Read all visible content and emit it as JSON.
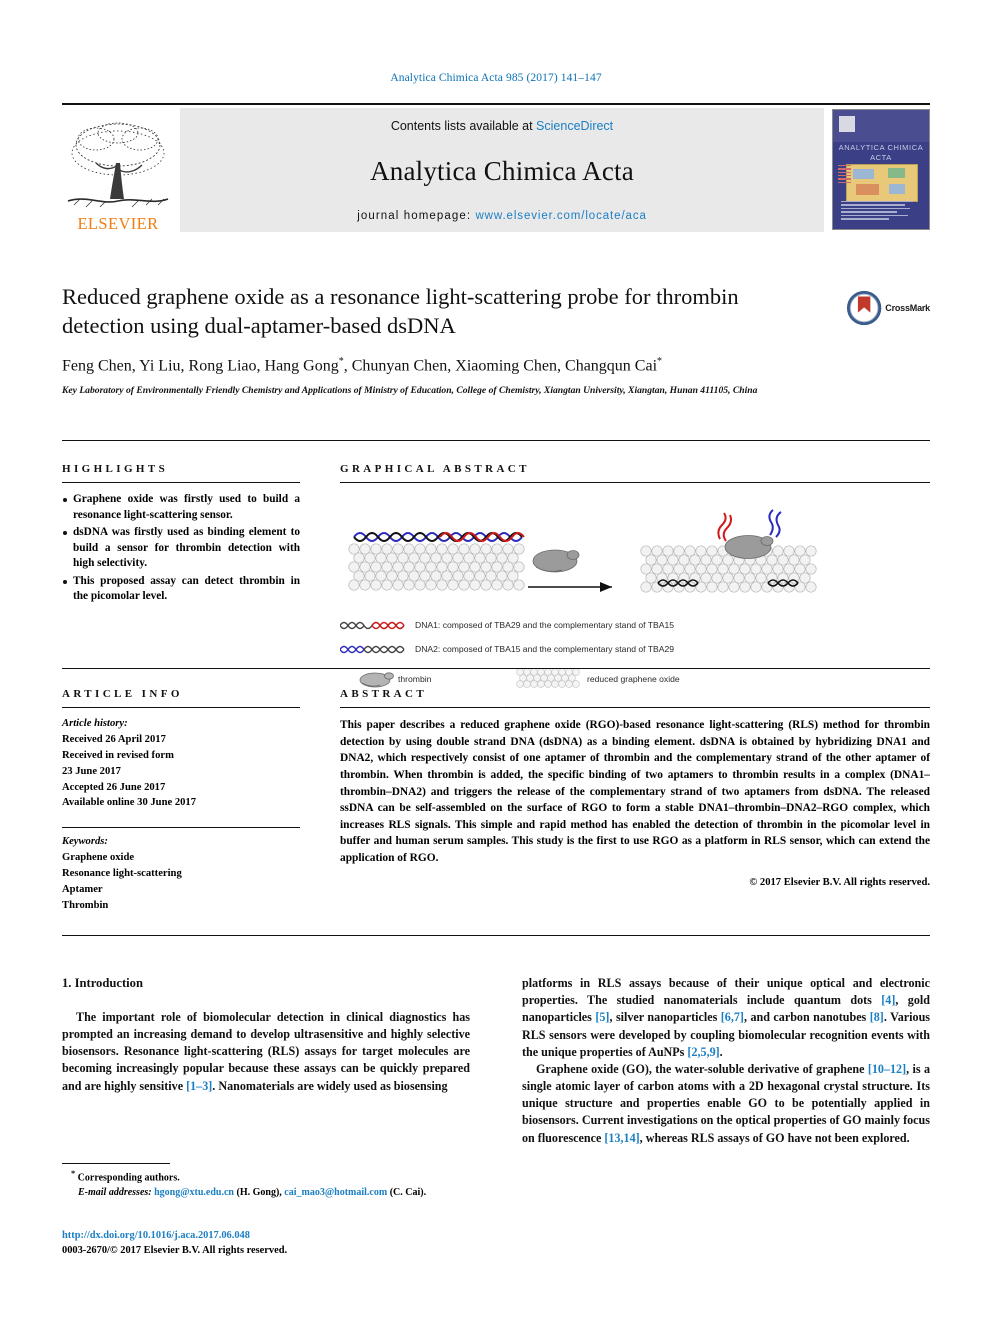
{
  "running_head": "Analytica Chimica Acta 985 (2017) 141–147",
  "masthead": {
    "publisher": "ELSEVIER",
    "contents_prefix": "Contents lists available at ",
    "contents_link": "ScienceDirect",
    "journal_title": "Analytica Chimica Acta",
    "homepage_prefix": "journal homepage: ",
    "homepage_url": "www.elsevier.com/locate/aca",
    "cover_title": "ANALYTICA CHIMICA ACTA"
  },
  "article": {
    "title": "Reduced graphene oxide as a resonance light-scattering probe for thrombin detection using dual-aptamer-based dsDNA",
    "authors": "Feng Chen, Yi Liu, Rong Liao, Hang Gong",
    "authors_mid": ", Chunyan Chen, Xiaoming Chen, Changqun Cai",
    "affiliation": "Key Laboratory of Environmentally Friendly Chemistry and Applications of Ministry of Education, College of Chemistry, Xiangtan University, Xiangtan, Hunan 411105, China",
    "crossmark_label": "CrossMark"
  },
  "highlights": {
    "heading": "HIGHLIGHTS",
    "items": [
      "Graphene oxide was firstly used to build a resonance light-scattering sensor.",
      "dsDNA was firstly used as binding element to build a sensor for thrombin detection with high selectivity.",
      "This proposed assay can detect thrombin in the picomolar level."
    ]
  },
  "graphical_abstract": {
    "heading": "GRAPHICAL ABSTRACT",
    "legend": [
      "DNA1: composed of TBA29 and the complementary stand of TBA15",
      "DNA2: composed of TBA15 and the complementary stand of TBA29"
    ],
    "legend_thrombin": "thrombin",
    "legend_rgo": "reduced graphene oxide"
  },
  "article_info": {
    "heading": "ARTICLE INFO",
    "history_label": "Article history:",
    "history": [
      "Received 26 April 2017",
      "Received in revised form",
      "23 June 2017",
      "Accepted 26 June 2017",
      "Available online 30 June 2017"
    ],
    "keywords_label": "Keywords:",
    "keywords": [
      "Graphene oxide",
      "Resonance light-scattering",
      "Aptamer",
      "Thrombin"
    ]
  },
  "abstract": {
    "heading": "ABSTRACT",
    "text": "This paper describes a reduced graphene oxide (RGO)-based resonance light-scattering (RLS) method for thrombin detection by using double strand DNA (dsDNA) as a binding element. dsDNA is obtained by hybridizing DNA1 and DNA2, which respectively consist of one aptamer of thrombin and the complementary strand of the other aptamer of thrombin. When thrombin is added, the specific binding of two aptamers to thrombin results in a complex (DNA1–thrombin–DNA2) and triggers the release of the complementary strand of two aptamers from dsDNA. The released ssDNA can be self-assembled on the surface of RGO to form a stable DNA1–thrombin–DNA2–RGO complex, which increases RLS signals. This simple and rapid method has enabled the detection of thrombin in the picomolar level in buffer and human serum samples. This study is the first to use RGO as a platform in RLS sensor, which can extend the application of RGO.",
    "copyright": "© 2017 Elsevier B.V. All rights reserved."
  },
  "introduction": {
    "section_number_title": "1. Introduction",
    "left_p1_a": "The important role of biomolecular detection in clinical diagnostics has prompted an increasing demand to develop ultrasensitive and highly selective biosensors. Resonance light-scattering (RLS) assays for target molecules are becoming increasingly popular because these assays can be quickly prepared and are highly sensitive ",
    "left_ref1": "[1–3]",
    "left_p1_b": ". Nanomaterials are widely used as biosensing",
    "right_p1_a": "platforms in RLS assays because of their unique optical and electronic properties. The studied nanomaterials include quantum dots ",
    "right_ref1": "[4]",
    "right_p1_b": ", gold nanoparticles ",
    "right_ref2": "[5]",
    "right_p1_c": ", silver nanoparticles ",
    "right_ref3": "[6,7]",
    "right_p1_d": ", and carbon nanotubes ",
    "right_ref4": "[8]",
    "right_p1_e": ". Various RLS sensors were developed by coupling biomolecular recognition events with the unique properties of AuNPs ",
    "right_ref5": "[2,5,9]",
    "right_p1_f": ".",
    "right_p2_a": "Graphene oxide (GO), the water-soluble derivative of graphene ",
    "right_ref6": "[10–12]",
    "right_p2_b": ", is a single atomic layer of carbon atoms with a 2D hexagonal crystal structure. Its unique structure and properties enable GO to be potentially applied in biosensors. Current investigations on the optical properties of GO mainly focus on fluorescence ",
    "right_ref7": "[13,14]",
    "right_p2_c": ", whereas RLS assays of GO have not been explored."
  },
  "footnote": {
    "corresponding": "Corresponding authors.",
    "email_label": "E-mail addresses:",
    "email1": "hgong@xtu.edu.cn",
    "email1_owner": "(H. Gong),",
    "email2": "cai_mao3@hotmail.com",
    "email2_owner": "(C. Cai).",
    "doi": "http://dx.doi.org/10.1016/j.aca.2017.06.048",
    "issn_line": "0003-2670/© 2017 Elsevier B.V. All rights reserved."
  },
  "colors": {
    "link": "#1b7fc4",
    "elsevier_orange": "#f07f13",
    "running_head": "#0b72b5"
  }
}
